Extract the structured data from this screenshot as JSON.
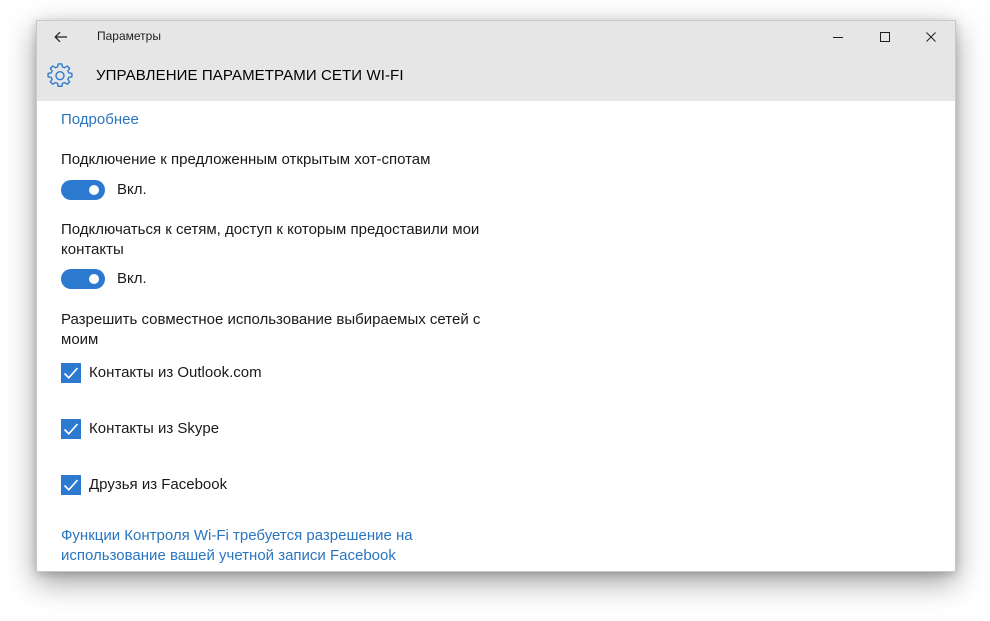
{
  "window": {
    "title": "Параметры"
  },
  "header": {
    "title": "УПРАВЛЕНИЕ ПАРАМЕТРАМИ СЕТИ WI-FI",
    "icon": "gear-icon"
  },
  "content": {
    "more_link": "Подробнее",
    "setting1": {
      "label": "Подключение к предложенным открытым хот-спотам",
      "state": "Вкл.",
      "on": true
    },
    "setting2": {
      "label_line1": "Подключаться к сетям, доступ к которым предоставили мои",
      "label_line2": "контакты",
      "state": "Вкл.",
      "on": true
    },
    "share": {
      "label_line1": "Разрешить совместное использование выбираемых сетей с",
      "label_line2": "моим",
      "options": [
        {
          "label": "Контакты из Outlook.com",
          "checked": true
        },
        {
          "label": "Контакты из Skype",
          "checked": true
        },
        {
          "label": "Друзья из Facebook",
          "checked": true
        }
      ]
    },
    "facebook_link_line1": "Функции Контроля Wi-Fi требуется разрешение на",
    "facebook_link_line2": "использование вашей учетной записи Facebook"
  },
  "colors": {
    "accent": "#2c7ad0",
    "link": "#2a75c0",
    "header_bg": "#e6e6e6"
  }
}
